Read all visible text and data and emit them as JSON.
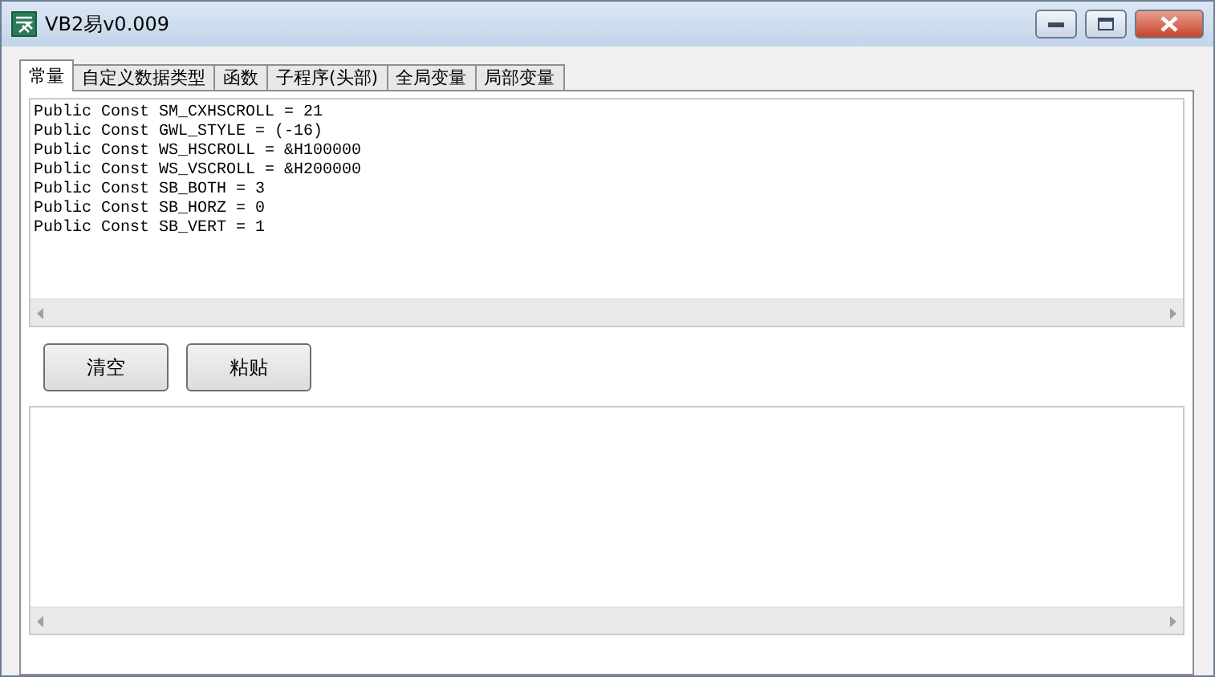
{
  "window": {
    "title": "VB2易v0.009"
  },
  "tabs": [
    {
      "label": "常量",
      "selected": true
    },
    {
      "label": "自定义数据类型",
      "selected": false
    },
    {
      "label": "函数",
      "selected": false
    },
    {
      "label": "子程序(头部)",
      "selected": false
    },
    {
      "label": "全局变量",
      "selected": false
    },
    {
      "label": "局部变量",
      "selected": false
    }
  ],
  "source": {
    "lines": [
      "Public Const SM_CXHSCROLL = 21",
      "Public Const GWL_STYLE = (-16)",
      "Public Const WS_HSCROLL = &H100000",
      "Public Const WS_VSCROLL = &H200000",
      "Public Const SB_BOTH = 3",
      "Public Const SB_HORZ = 0",
      "Public Const SB_VERT = 1"
    ]
  },
  "buttons": [
    {
      "label": "清空"
    },
    {
      "label": "粘贴"
    }
  ]
}
